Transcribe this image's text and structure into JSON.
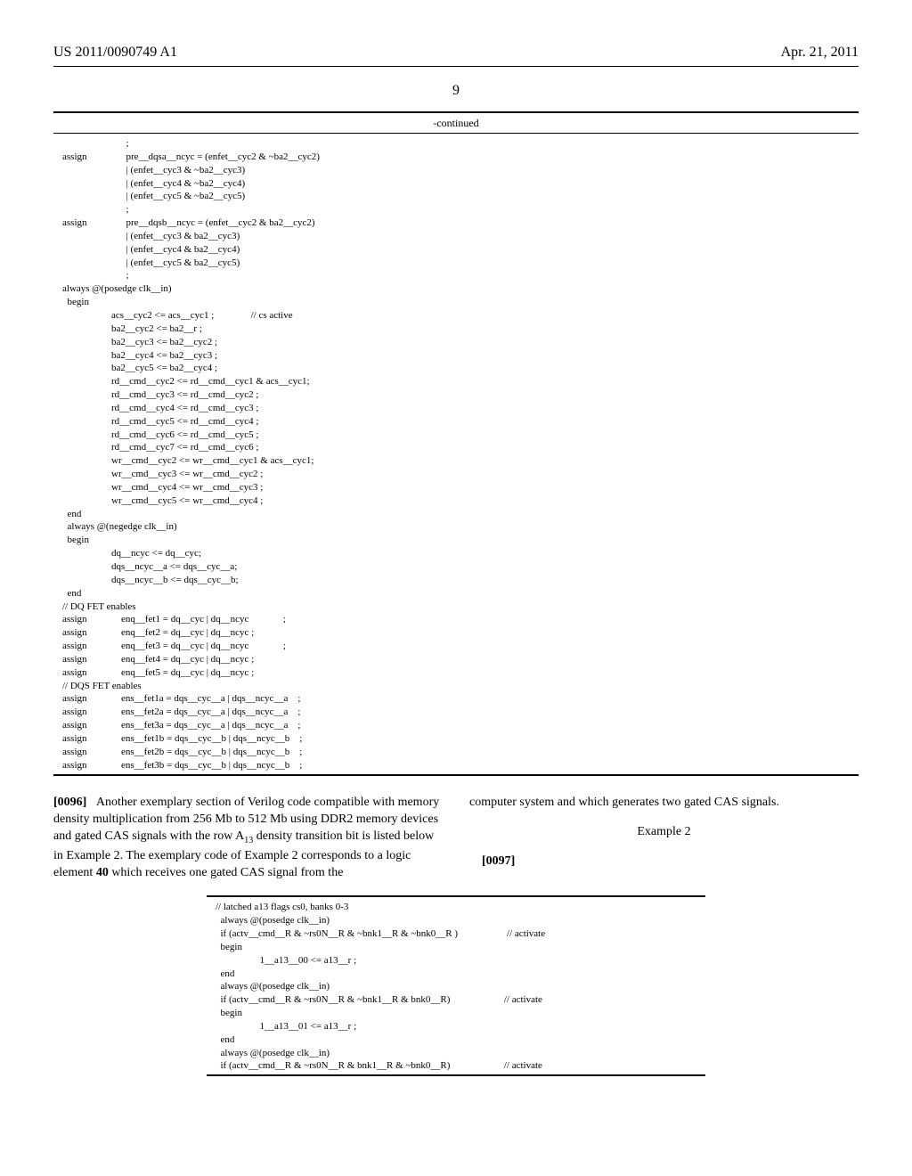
{
  "header": {
    "left": "US 2011/0090749 A1",
    "right": "Apr. 21, 2011"
  },
  "page_number": "9",
  "code_top": {
    "caption": "-continued",
    "lines": [
      "                          ;",
      "assign                pre__dqsa__ncyc = (enfet__cyc2 & ~ba2__cyc2)",
      "                          | (enfet__cyc3 & ~ba2__cyc3)",
      "                          | (enfet__cyc4 & ~ba2__cyc4)",
      "                          | (enfet__cyc5 & ~ba2__cyc5)",
      "                          ;",
      "assign                pre__dqsb__ncyc = (enfet__cyc2 & ba2__cyc2)",
      "                          | (enfet__cyc3 & ba2__cyc3)",
      "                          | (enfet__cyc4 & ba2__cyc4)",
      "                          | (enfet__cyc5 & ba2__cyc5)",
      "                          ;",
      "always @(posedge clk__in)",
      "  begin",
      "                    acs__cyc2 <= acs__cyc1 ;               // cs active",
      "                    ba2__cyc2 <= ba2__r ;",
      "                    ba2__cyc3 <= ba2__cyc2 ;",
      "                    ba2__cyc4 <= ba2__cyc3 ;",
      "                    ba2__cyc5 <= ba2__cyc4 ;",
      "                    rd__cmd__cyc2 <= rd__cmd__cyc1 & acs__cyc1;",
      "                    rd__cmd__cyc3 <= rd__cmd__cyc2 ;",
      "                    rd__cmd__cyc4 <= rd__cmd__cyc3 ;",
      "                    rd__cmd__cyc5 <= rd__cmd__cyc4 ;",
      "                    rd__cmd__cyc6 <= rd__cmd__cyc5 ;",
      "                    rd__cmd__cyc7 <= rd__cmd__cyc6 ;",
      "                    wr__cmd__cyc2 <= wr__cmd__cyc1 & acs__cyc1;",
      "                    wr__cmd__cyc3 <= wr__cmd__cyc2 ;",
      "                    wr__cmd__cyc4 <= wr__cmd__cyc3 ;",
      "                    wr__cmd__cyc5 <= wr__cmd__cyc4 ;",
      "  end",
      "  always @(negedge clk__in)",
      "  begin",
      "                    dq__ncyc <= dq__cyc;",
      "                    dqs__ncyc__a <= dqs__cyc__a;",
      "                    dqs__ncyc__b <= dqs__cyc__b;",
      "  end",
      "// DQ FET enables",
      "assign              enq__fet1 = dq__cyc | dq__ncyc              ;",
      "assign              enq__fet2 = dq__cyc | dq__ncyc ;",
      "assign              enq__fet3 = dq__cyc | dq__ncyc              ;",
      "assign              enq__fet4 = dq__cyc | dq__ncyc ;",
      "assign              enq__fet5 = dq__cyc | dq__ncyc ;",
      "// DQS FET enables",
      "assign              ens__fet1a = dqs__cyc__a | dqs__ncyc__a    ;",
      "assign              ens__fet2a = dqs__cyc__a | dqs__ncyc__a    ;",
      "assign              ens__fet3a = dqs__cyc__a | dqs__ncyc__a    ;",
      "assign              ens__fet1b = dqs__cyc__b | dqs__ncyc__b    ;",
      "assign              ens__fet2b = dqs__cyc__b | dqs__ncyc__b    ;",
      "assign              ens__fet3b = dqs__cyc__b | dqs__ncyc__b    ;"
    ]
  },
  "body": {
    "para96_num": "[0096]",
    "para96_text_a": "Another exemplary section of Verilog code compatible with memory density multiplication from 256 Mb to 512 Mb using DDR2 memory devices and gated CAS signals with the row A",
    "para96_sub": "13",
    "para96_text_b": " density transition bit is listed below in Example 2. The exemplary code of Example 2 corresponds to a logic element ",
    "para96_bold": "40",
    "para96_text_c": " which receives one gated CAS signal from the",
    "para96_right": "computer system and which generates two gated CAS signals.",
    "example_label": "Example 2",
    "para97_num": "[0097]"
  },
  "code_bottom": {
    "lines": [
      "// latched a13 flags cs0, banks 0-3",
      "  always @(posedge clk__in)",
      "  if (actv__cmd__R & ~rs0N__R & ~bnk1__R & ~bnk0__R )                    // activate",
      "  begin",
      "                  1__a13__00 <= a13__r ;",
      "  end",
      "  always @(posedge clk__in)",
      "  if (actv__cmd__R & ~rs0N__R & ~bnk1__R & bnk0__R)                      // activate",
      "  begin",
      "                  1__a13__01 <= a13__r ;",
      "  end",
      "  always @(posedge clk__in)",
      "  if (actv__cmd__R & ~rs0N__R & bnk1__R & ~bnk0__R)                      // activate"
    ]
  }
}
